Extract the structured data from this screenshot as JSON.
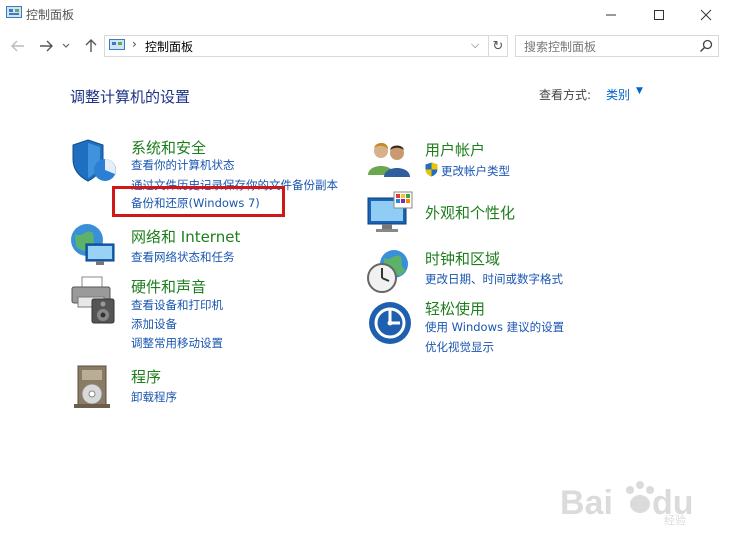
{
  "window": {
    "title": "控制面板"
  },
  "address": {
    "path": "控制面板",
    "search_placeholder": "搜索控制面板"
  },
  "content": {
    "heading": "调整计算机的设置",
    "view_by_label": "查看方式:",
    "view_by_value": "类别"
  },
  "categories": [
    {
      "title": "系统和安全",
      "links": [
        "查看你的计算机状态",
        "通过文件历史记录保存你的文件备份副本",
        "备份和还原(Windows 7)"
      ]
    },
    {
      "title": "网络和 Internet",
      "links": [
        "查看网络状态和任务"
      ]
    },
    {
      "title": "硬件和声音",
      "links": [
        "查看设备和打印机",
        "添加设备",
        "调整常用移动设置"
      ]
    },
    {
      "title": "程序",
      "links": [
        "卸载程序"
      ]
    },
    {
      "title": "用户帐户",
      "links": [
        "更改帐户类型"
      ]
    },
    {
      "title": "外观和个性化",
      "links": []
    },
    {
      "title": "时钟和区域",
      "links": [
        "更改日期、时间或数字格式"
      ]
    },
    {
      "title": "轻松使用",
      "links": [
        "使用 Windows 建议的设置",
        "优化视觉显示"
      ]
    }
  ],
  "watermark": {
    "text": "Baidu经验"
  },
  "colors": {
    "heading": "#1e3287",
    "category": "#1e7e1e",
    "link": "#1a56b0",
    "highlight": "#d01818"
  }
}
